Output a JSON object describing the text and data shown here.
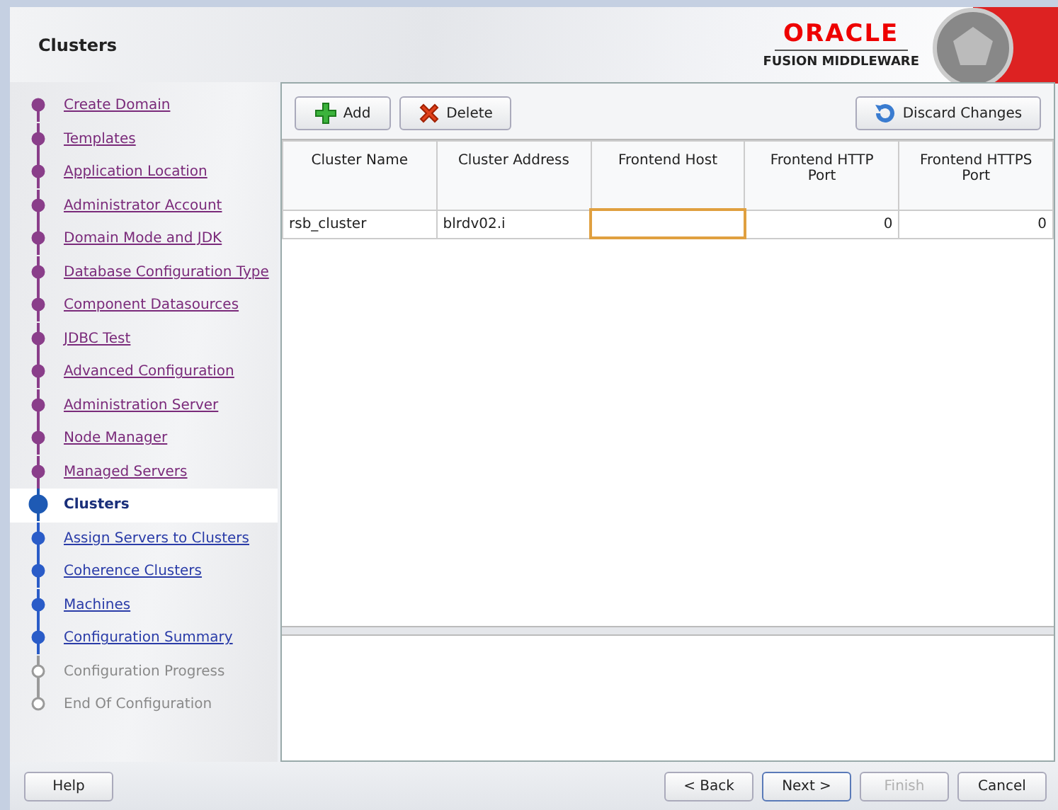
{
  "window": {
    "title": "Clusters"
  },
  "brand": {
    "name": "ORACLE",
    "product": "FUSION MIDDLEWARE"
  },
  "steps": [
    {
      "label": "Create Domain",
      "kind": "visited",
      "selected": false
    },
    {
      "label": "Templates",
      "kind": "visited",
      "selected": false
    },
    {
      "label": "Application Location",
      "kind": "visited",
      "selected": false
    },
    {
      "label": "Administrator Account",
      "kind": "visited",
      "selected": false
    },
    {
      "label": "Domain Mode and JDK",
      "kind": "visited",
      "selected": false
    },
    {
      "label": "Database Configuration Type",
      "kind": "visited",
      "selected": false
    },
    {
      "label": "Component Datasources",
      "kind": "visited",
      "selected": false
    },
    {
      "label": "JDBC Test",
      "kind": "visited",
      "selected": false
    },
    {
      "label": "Advanced Configuration",
      "kind": "visited",
      "selected": false
    },
    {
      "label": "Administration Server",
      "kind": "visited",
      "selected": false
    },
    {
      "label": "Node Manager",
      "kind": "visited",
      "selected": false
    },
    {
      "label": "Managed Servers",
      "kind": "visited",
      "selected": false
    },
    {
      "label": "Clusters",
      "kind": "current",
      "selected": true
    },
    {
      "label": "Assign Servers to Clusters",
      "kind": "pending",
      "selected": false
    },
    {
      "label": "Coherence Clusters",
      "kind": "pending",
      "selected": false
    },
    {
      "label": "Machines",
      "kind": "pending",
      "selected": false
    },
    {
      "label": "Configuration Summary",
      "kind": "pending",
      "selected": false
    },
    {
      "label": "Configuration Progress",
      "kind": "disabled",
      "selected": false
    },
    {
      "label": "End Of Configuration",
      "kind": "disabled",
      "selected": false
    }
  ],
  "toolbar": [
    {
      "label": "Add",
      "kind": "add"
    },
    {
      "label": "Delete",
      "kind": "delete"
    },
    {
      "label": "Discard Changes",
      "kind": "discard"
    }
  ],
  "table": {
    "columns": [
      "Cluster Name",
      "Cluster Address",
      "Frontend Host",
      "Frontend HTTP Port",
      "Frontend HTTPS Port"
    ],
    "rows": [
      {
        "cells": [
          {
            "text": "rsb_cluster",
            "focused": false
          },
          {
            "text": "blrdv02.i",
            "focused": false
          },
          {
            "text": "",
            "focused": true
          },
          {
            "text": "0",
            "focused": false
          },
          {
            "text": "0",
            "focused": false
          }
        ]
      }
    ]
  },
  "footer": {
    "help": "Help",
    "buttons": [
      {
        "label": "< Back",
        "disabled": false,
        "default": false
      },
      {
        "label": "Next >",
        "disabled": false,
        "default": true
      },
      {
        "label": "Finish",
        "disabled": true,
        "default": false
      },
      {
        "label": "Cancel",
        "disabled": false,
        "default": false
      }
    ]
  }
}
